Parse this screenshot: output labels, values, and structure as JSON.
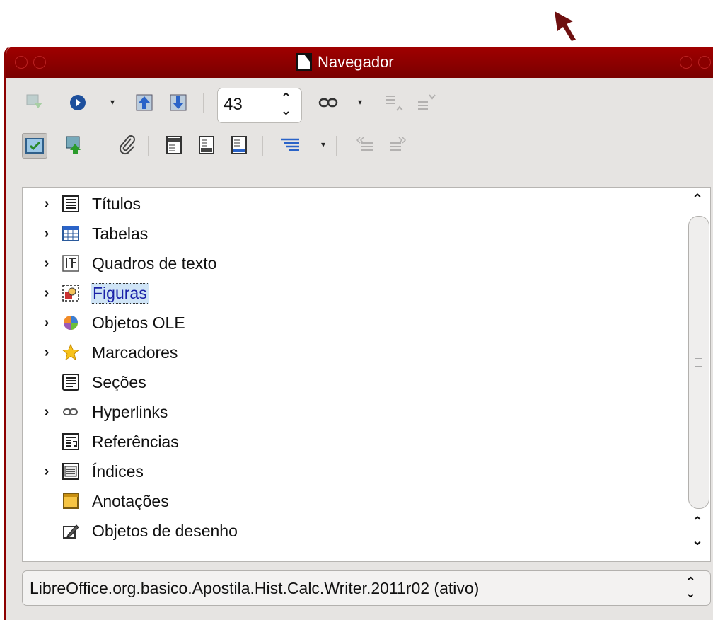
{
  "window": {
    "title": "Navegador"
  },
  "toolbar1": {
    "page_value": "43",
    "icons": [
      "toggle-icon",
      "navigate-by-icon",
      "previous-icon",
      "next-icon",
      "drag-mode-icon",
      "promote-level-icon",
      "demote-level-icon"
    ]
  },
  "toolbar2": {
    "icons": [
      "content-view-icon",
      "update-icon",
      "insert-icon",
      "header-icon",
      "footer-icon",
      "anchor-icon",
      "heading-levels-icon",
      "promote-chapter-icon",
      "demote-chapter-icon"
    ]
  },
  "tree": {
    "items": [
      {
        "label": "Títulos",
        "expandable": true,
        "icon": "headings-icon"
      },
      {
        "label": "Tabelas",
        "expandable": true,
        "icon": "table-icon"
      },
      {
        "label": "Quadros de texto",
        "expandable": true,
        "icon": "frame-icon"
      },
      {
        "label": "Figuras",
        "expandable": true,
        "icon": "image-icon",
        "selected": true
      },
      {
        "label": "Objetos OLE",
        "expandable": true,
        "icon": "ole-icon"
      },
      {
        "label": "Marcadores",
        "expandable": true,
        "icon": "star-icon"
      },
      {
        "label": "Seções",
        "expandable": false,
        "icon": "section-icon"
      },
      {
        "label": "Hyperlinks",
        "expandable": true,
        "icon": "link-icon"
      },
      {
        "label": "Referências",
        "expandable": false,
        "icon": "reference-icon"
      },
      {
        "label": "Índices",
        "expandable": true,
        "icon": "index-icon"
      },
      {
        "label": "Anotações",
        "expandable": false,
        "icon": "comment-icon"
      },
      {
        "label": "Objetos de desenho",
        "expandable": false,
        "icon": "drawing-icon"
      }
    ]
  },
  "document_select": {
    "value": "LibreOffice.org.basico.Apostila.Hist.Calc.Writer.2011r02 (ativo)"
  },
  "colors": {
    "titlebar": "#8c0000",
    "selection": "#cfe4f6",
    "selected_text": "#1a22a8"
  }
}
